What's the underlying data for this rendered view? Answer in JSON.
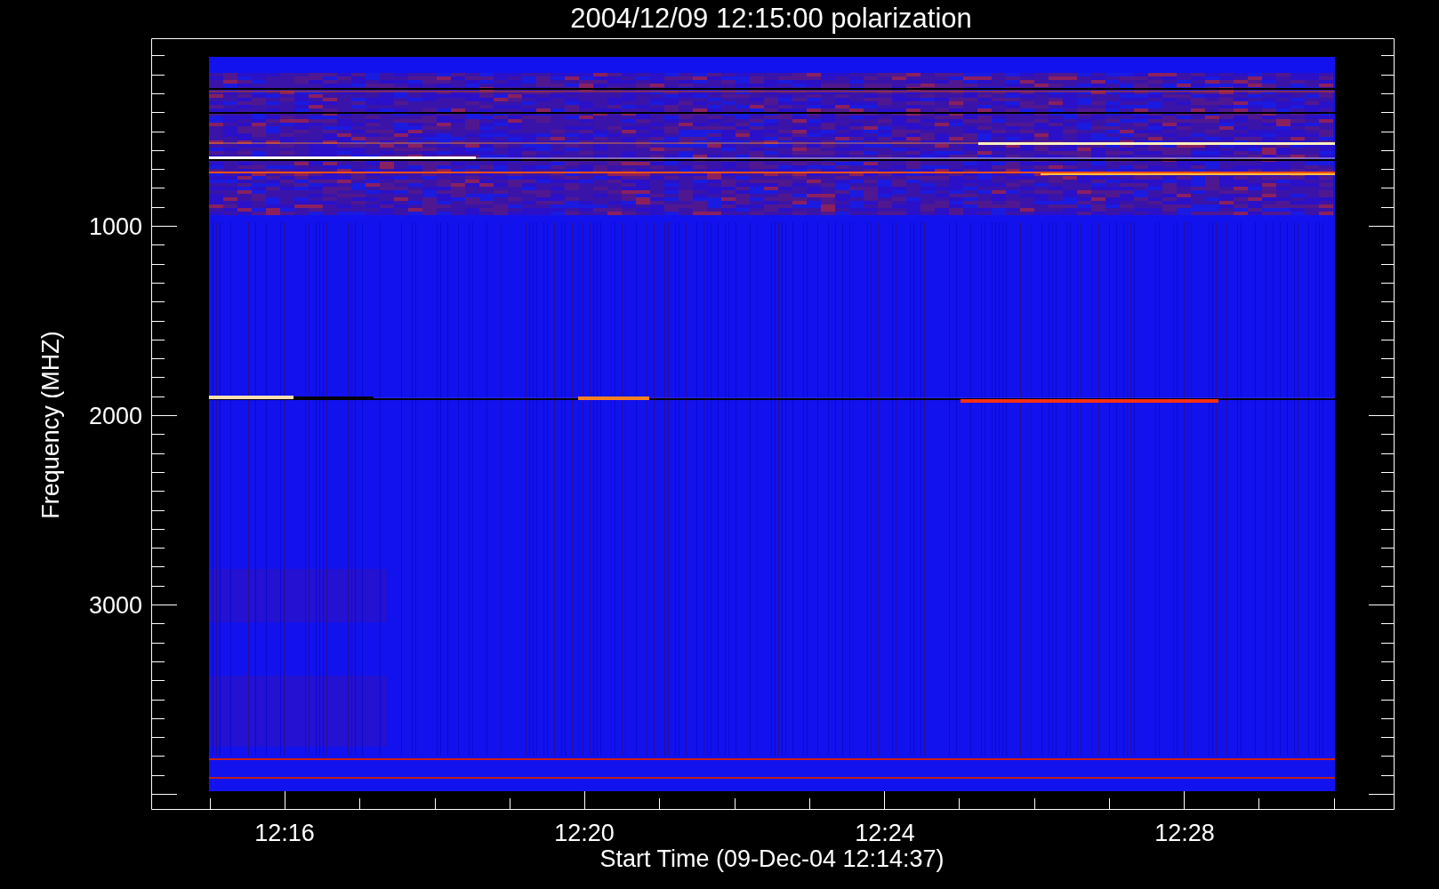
{
  "title": "2004/12/09 12:15:00 polarization",
  "y_axis": {
    "label": "Frequency (MHZ)",
    "tick_labels": [
      "1000",
      "2000",
      "3000"
    ]
  },
  "x_axis": {
    "label": "Start Time (09-Dec-04 12:14:37)",
    "tick_labels": [
      "12:16",
      "12:20",
      "12:24",
      "12:28"
    ]
  }
}
